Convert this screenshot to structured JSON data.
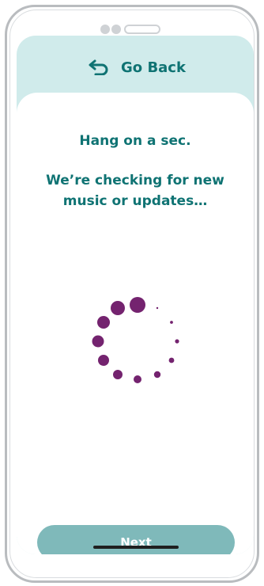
{
  "header": {
    "back_label": "Go Back",
    "back_icon": "back-arrow-icon"
  },
  "message": {
    "line1": "Hang on a sec.",
    "line2": "We’re checking for new music or updates…"
  },
  "footer": {
    "next_label": "Next"
  },
  "spinner": {
    "icon": "loading-spinner-icon",
    "color": "#74236f"
  },
  "colors": {
    "accent": "#0f7373",
    "header_bg": "#d0ebeb",
    "button_bg": "#7fb9ba"
  }
}
